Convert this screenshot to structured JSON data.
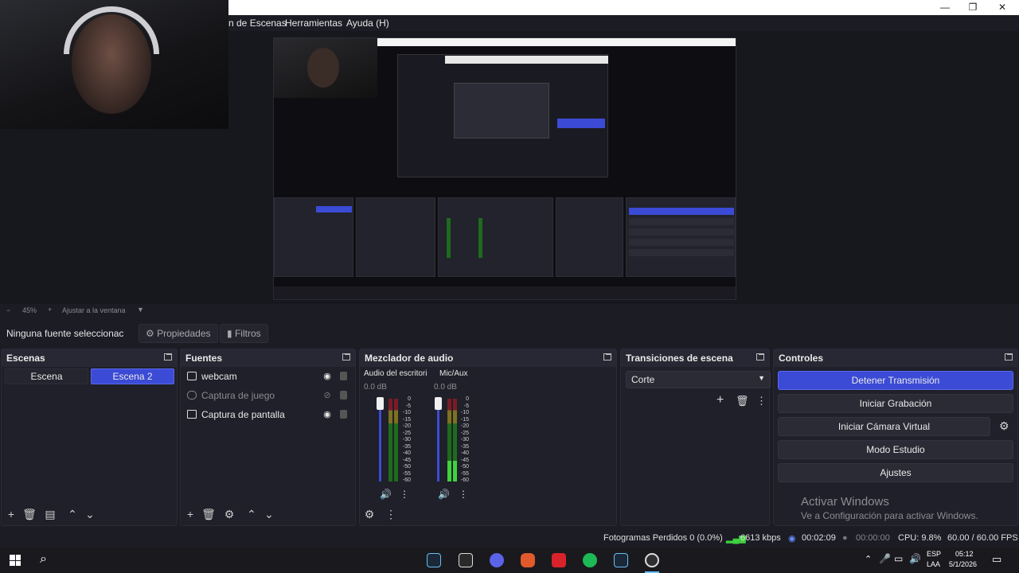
{
  "window": {
    "minimize": "—",
    "restore": "❐",
    "close": "✕"
  },
  "menu": {
    "items": [
      "n de Escenas",
      "Herramientas",
      "Ayuda (H)"
    ]
  },
  "preview": {
    "zoom": "45%",
    "fit_label": "Ajustar a la ventana",
    "zoom_minus": "−",
    "zoom_plus": "+"
  },
  "source_toolbar": {
    "no_source": "Ninguna fuente seleccionac",
    "properties": "Propiedades",
    "filters": "Filtros"
  },
  "scenes": {
    "title": "Escenas",
    "items": [
      {
        "label": "Escena",
        "active": false
      },
      {
        "label": "Escena 2",
        "active": true
      }
    ]
  },
  "sources": {
    "title": "Fuentes",
    "items": [
      {
        "label": "webcam",
        "visible": true
      },
      {
        "label": "Captura de juego",
        "visible": false
      },
      {
        "label": "Captura de pantalla",
        "visible": true
      }
    ]
  },
  "mixer": {
    "title": "Mezclador de audio",
    "channels": [
      {
        "name": "Audio del escritorio",
        "db": "0.0 dB"
      },
      {
        "name": "Mic/Aux",
        "db": "0.0 dB"
      }
    ],
    "ticks": [
      "0",
      "-5",
      "-10",
      "-15",
      "-20",
      "-25",
      "-30",
      "-35",
      "-40",
      "-45",
      "-50",
      "-55",
      "-60"
    ]
  },
  "transitions": {
    "title": "Transiciones de escena",
    "selected": "Corte"
  },
  "controls": {
    "title": "Controles",
    "stop_stream": "Detener Transmisión",
    "start_recording": "Iniciar Grabación",
    "virtual_camera": "Iniciar Cámara Virtual",
    "studio_mode": "Modo Estudio",
    "settings": "Ajustes"
  },
  "activation": {
    "line1": "Activar Windows",
    "line2": "Ve a Configuración para activar Windows."
  },
  "status": {
    "dropped_frames": "Fotogramas Perdidos 0 (0.0%)",
    "bitrate": "6613 kbps",
    "live_time": "00:02:09",
    "rec_time": "00:00:00",
    "cpu": "CPU: 9.8%",
    "fps": "60.00 / 60.00 FPS"
  },
  "taskbar": {
    "lang1": "ESP",
    "lang2": "LAA",
    "time": "05:12",
    "date": "5/1/2026"
  },
  "colors": {
    "accent": "#3b4bd6",
    "bg": "#1b1c24",
    "dock": "#1f2029",
    "meter_green": "#1e6b1e"
  }
}
